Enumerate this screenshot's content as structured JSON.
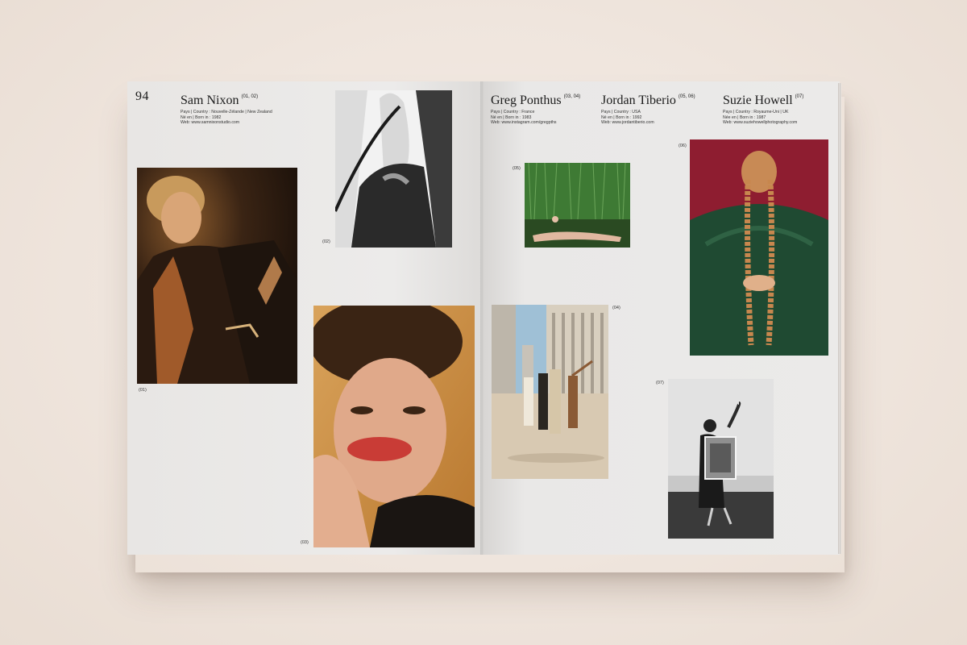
{
  "spread": {
    "page_number": "94",
    "photographers": [
      {
        "name": "Sam Nixon",
        "refs": "(01, 02)",
        "country": "Pays | Country : Nouvelle-Zélande | New Zealand",
        "born": "Né en | Born in : 1982",
        "web": "Web: www.samnixonstudio.com"
      },
      {
        "name": "Greg Ponthus",
        "refs": "(03, 04)",
        "country": "Pays | Country : France",
        "born": "Né en | Born in : 1983",
        "web": "Web: www.instagram.com/gregpths"
      },
      {
        "name": "Jordan Tiberio",
        "refs": "(05, 06)",
        "country": "Pays | Country : USA",
        "born": "Né en | Born in : 1992",
        "web": "Web: www.jordantiberio.com"
      },
      {
        "name": "Suzie Howell",
        "refs": "(07)",
        "country": "Pays | Country : Royaume-Uni | UK",
        "born": "Née en | Born in : 1987",
        "web": "Web: www.suziehowellphotography.com"
      }
    ],
    "captions": {
      "p01": "(01)",
      "p02": "(02)",
      "p03": "(03)",
      "p04": "(04)",
      "p05": "(05)",
      "p06": "(06)",
      "p07": "(07)"
    }
  },
  "colors": {
    "background": "#efe5dd",
    "paper": "#eae8e7",
    "text": "#1c1c1c"
  }
}
